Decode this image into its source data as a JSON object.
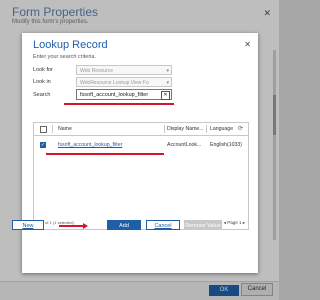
{
  "background": {
    "title": "Form Properties",
    "subtitle": "Modify this form's properties.",
    "ok_label": "OK",
    "cancel_label": "Cancel"
  },
  "dialog": {
    "title": "Lookup Record",
    "subtitle": "Enter your search criteria.",
    "look_for_label": "Look for",
    "look_for_value": "Web Resource",
    "look_in_label": "Look in",
    "look_in_value": "WebResource Lookup View Fo",
    "search_label": "Search",
    "search_value": "fssoft_account_lookup_filter",
    "grid": {
      "columns": [
        "Name",
        "Display Name...",
        "Language"
      ],
      "rows": [
        {
          "name": "fssoft_account_lookup_filter",
          "display_name": "AccountLook...",
          "language": "English(1033)"
        }
      ],
      "footer_left": "1 - 1 of 1 (1 selected)",
      "footer_right": "Page 1"
    },
    "buttons": {
      "new": "New",
      "add": "Add",
      "cancel": "Cancel",
      "remove": "Remove Value"
    }
  },
  "colors": {
    "accent": "#1f5fa8",
    "highlight": "#d8142c"
  }
}
